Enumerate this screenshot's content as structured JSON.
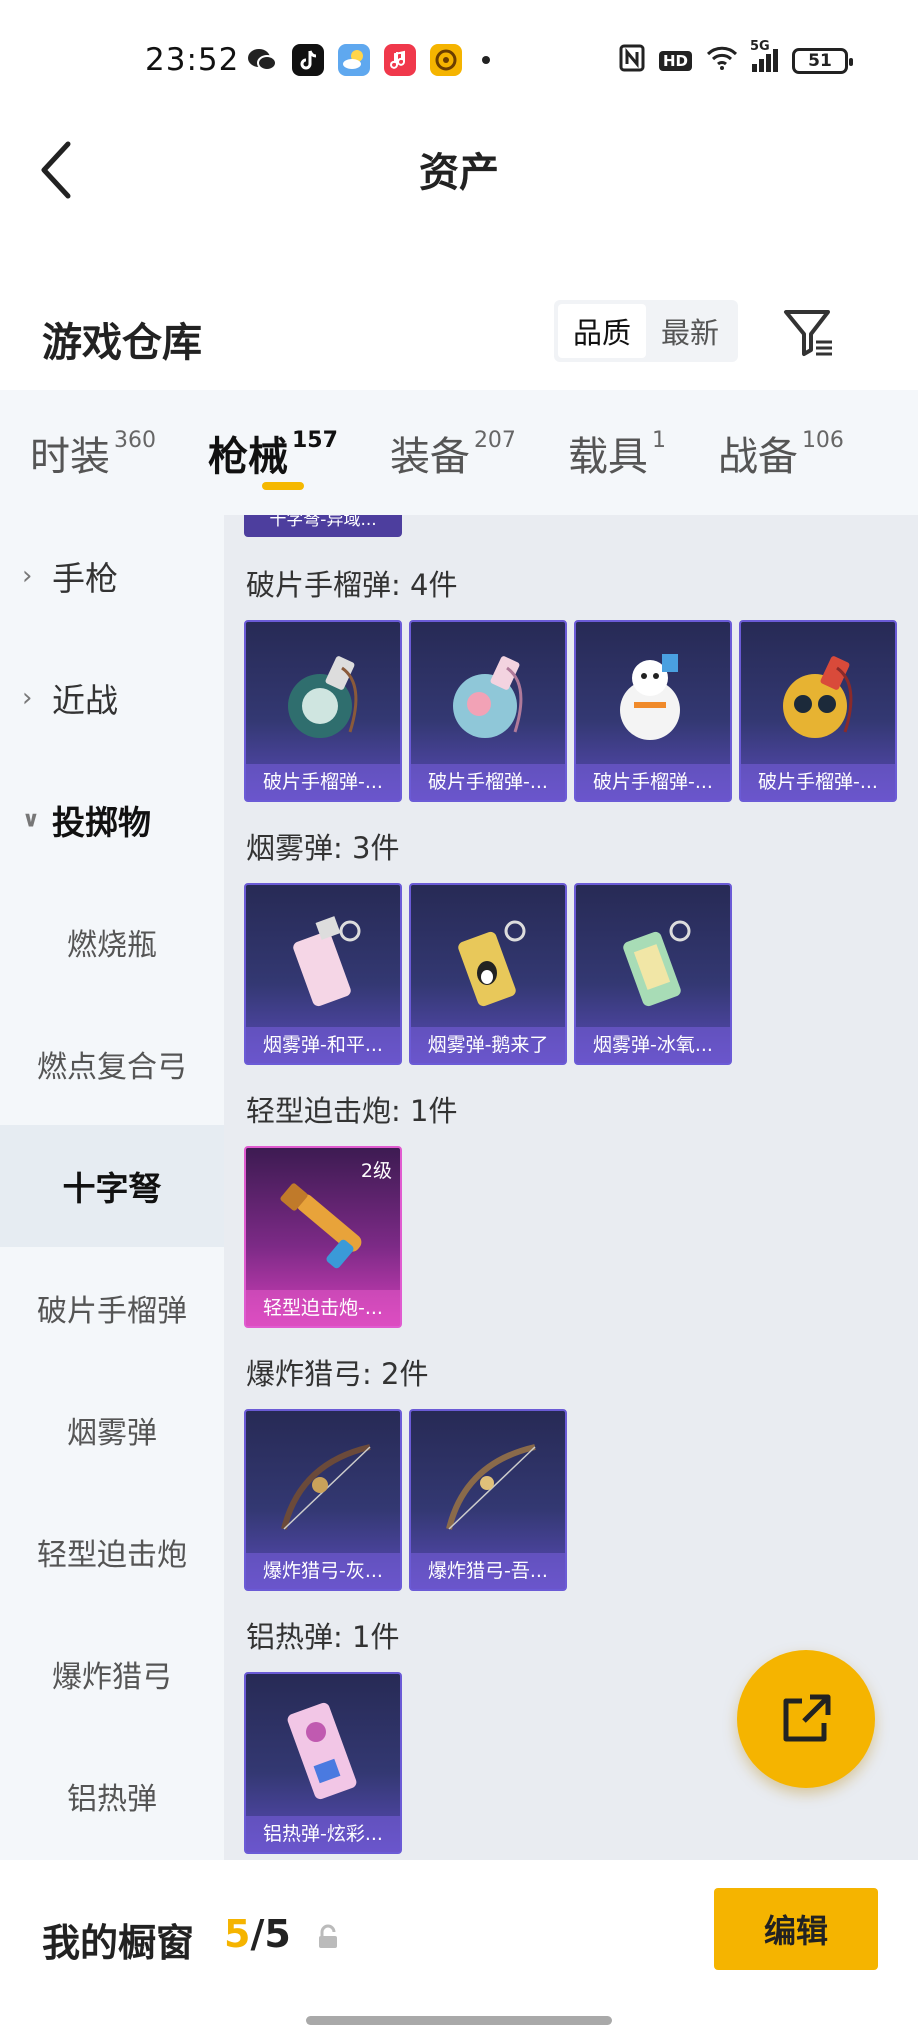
{
  "status": {
    "time": "23:52",
    "network": "5G",
    "battery": "51",
    "hd": "HD"
  },
  "nav": {
    "title": "资产",
    "back_icon": "chevron-left-icon"
  },
  "warehouse": {
    "title": "游戏仓库",
    "sort_options": [
      "品质",
      "最新"
    ],
    "active_sort": "品质",
    "filter_icon": "filter-icon"
  },
  "tabs": [
    {
      "label": "时装",
      "count": "360"
    },
    {
      "label": "枪械",
      "count": "157",
      "active": true
    },
    {
      "label": "装备",
      "count": "207"
    },
    {
      "label": "载具",
      "count": "1"
    },
    {
      "label": "战备",
      "count": "106"
    }
  ],
  "sidebar": {
    "parents": [
      {
        "label": "手枪",
        "icon": "chevron-right-icon"
      },
      {
        "label": "近战",
        "icon": "chevron-right-icon"
      },
      {
        "label": "投掷物",
        "icon": "chevron-down-icon"
      }
    ],
    "children": [
      {
        "label": "燃烧瓶"
      },
      {
        "label": "燃点复合弓"
      },
      {
        "label": "十字弩",
        "active": true
      },
      {
        "label": "破片手榴弹"
      },
      {
        "label": "烟雾弹"
      },
      {
        "label": "轻型迫击炮"
      },
      {
        "label": "爆炸猎弓"
      },
      {
        "label": "铝热弹"
      }
    ]
  },
  "content": {
    "partial_card_label": "十字弩-异域...",
    "groups": [
      {
        "title": "破片手榴弹: 4件",
        "items": [
          {
            "label": "破片手榴弹-..."
          },
          {
            "label": "破片手榴弹-..."
          },
          {
            "label": "破片手榴弹-..."
          },
          {
            "label": "破片手榴弹-..."
          }
        ]
      },
      {
        "title": "烟雾弹: 3件",
        "items": [
          {
            "label": "烟雾弹-和平..."
          },
          {
            "label": "烟雾弹-鹅来了"
          },
          {
            "label": "烟雾弹-冰氧..."
          }
        ]
      },
      {
        "title": "轻型迫击炮: 1件",
        "items": [
          {
            "label": "轻型迫击炮-...",
            "level": "2级"
          }
        ]
      },
      {
        "title": "爆炸猎弓: 2件",
        "items": [
          {
            "label": "爆炸猎弓-灰..."
          },
          {
            "label": "爆炸猎弓-吾..."
          }
        ]
      },
      {
        "title": "铝热弹: 1件",
        "items": [
          {
            "label": "铝热弹-炫彩..."
          }
        ]
      }
    ]
  },
  "fab": {
    "icon": "share-icon"
  },
  "bottom": {
    "title": "我的橱窗",
    "current": "5",
    "separator": "/",
    "total": "5",
    "edit_label": "编辑",
    "lock_icon": "lock-icon"
  },
  "colors": {
    "accent": "#f5b400",
    "card_purple": "#5a4bb8",
    "card_pink": "#d23fb9"
  }
}
